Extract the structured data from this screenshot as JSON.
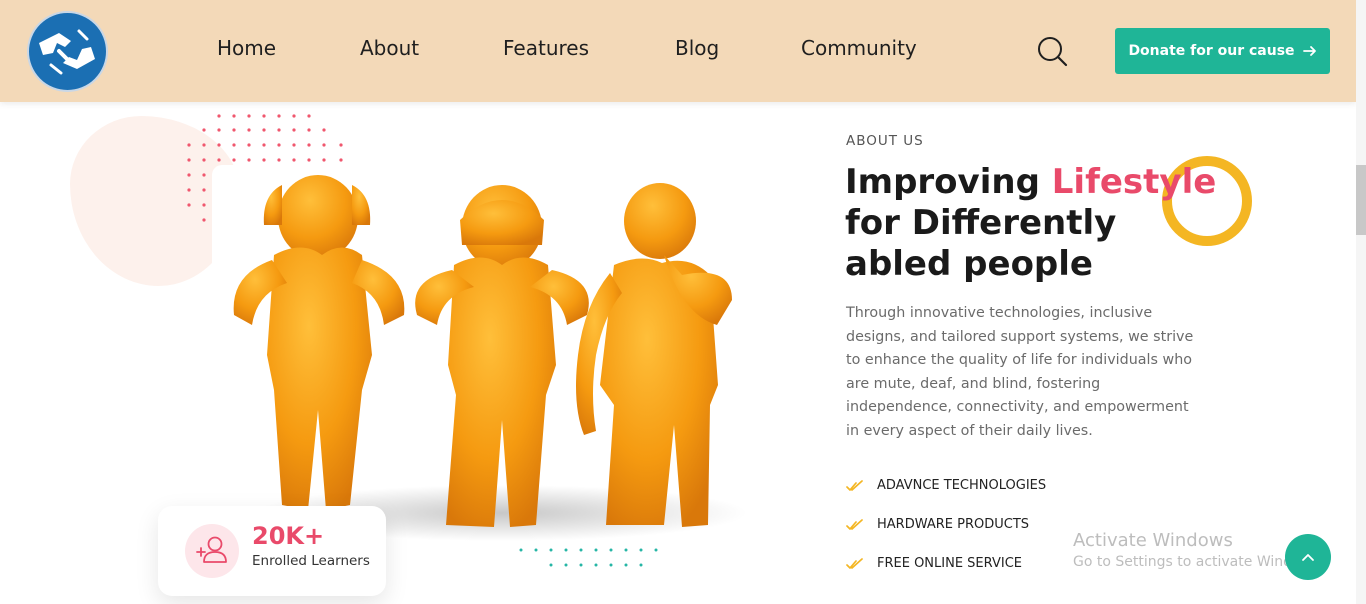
{
  "header": {
    "logo_alt": "sign language hands logo",
    "nav": [
      {
        "label": "Home"
      },
      {
        "label": "About"
      },
      {
        "label": "Features"
      },
      {
        "label": "Blog"
      },
      {
        "label": "Community"
      }
    ],
    "search_icon": "search-icon",
    "donate_label": "Donate for our cause",
    "donate_icon": "arrow-right-icon"
  },
  "about": {
    "eyebrow": "ABOUT US",
    "heading_part1": "Improving ",
    "heading_accent": "Lifestyle",
    "heading_part2": " for Differently abled people",
    "paragraph": "Through innovative technologies, inclusive designs, and tailored support systems, we strive to enhance the quality of life for individuals who are mute, deaf, and blind, fostering independence, connectivity, and empowerment in every aspect of their daily lives.",
    "features": [
      {
        "label": "ADAVNCE TECHNOLOGIES"
      },
      {
        "label": "HARDWARE PRODUCTS"
      },
      {
        "label": "FREE ONLINE SERVICE"
      }
    ]
  },
  "stat": {
    "value": "20K+",
    "label": "Enrolled Learners",
    "icon": "user-add-icon"
  },
  "watermark": {
    "title": "Activate Windows",
    "subtitle": "Go to Settings to activate Windows."
  },
  "colors": {
    "header_bg": "#f3d9b8",
    "accent_teal": "#1fb597",
    "accent_pink": "#e94a6a",
    "accent_yellow": "#f4b623",
    "figure_orange": "#f39a12"
  }
}
